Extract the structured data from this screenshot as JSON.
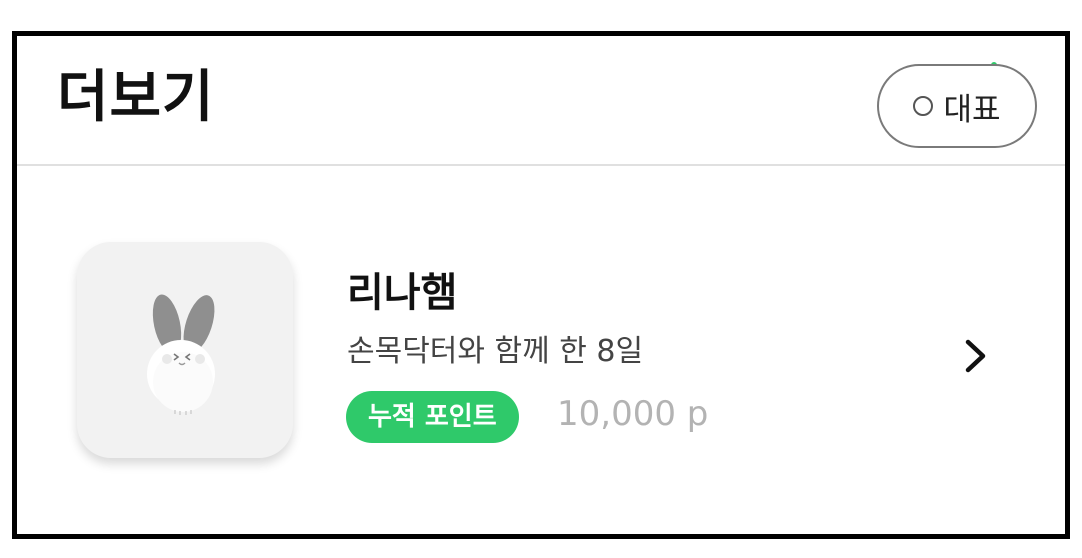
{
  "header": {
    "title": "더보기",
    "representative_button": {
      "label": "대표",
      "icon": "circle-icon",
      "selected": false
    },
    "status_dot_color": "#2fc96a"
  },
  "profile": {
    "name": "리나햄",
    "subtitle": "손목닥터와 함께 한 8일",
    "points_badge": "누적 포인트",
    "points_value": "10,000 p",
    "avatar_icon": "bunny-character-icon",
    "arrow_icon": "chevron-right-icon"
  },
  "colors": {
    "accent_green": "#2fc96a",
    "points_gray": "#b3b3b3",
    "divider": "#e0e0e0"
  }
}
